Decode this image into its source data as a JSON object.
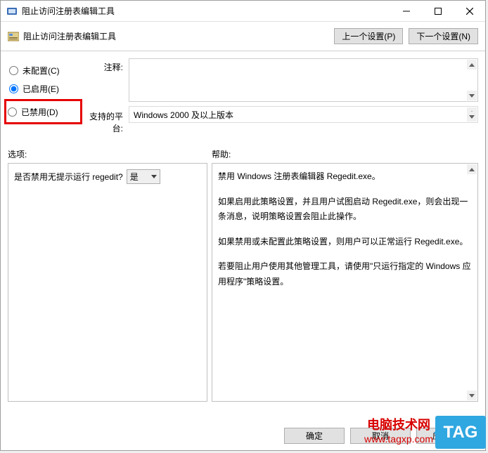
{
  "window": {
    "title": "阻止访问注册表编辑工具"
  },
  "header": {
    "title": "阻止访问注册表编辑工具",
    "prev_btn": "上一个设置(P)",
    "next_btn": "下一个设置(N)"
  },
  "radios": {
    "not_configured": "未配置(C)",
    "enabled": "已启用(E)",
    "disabled": "已禁用(D)",
    "selected": "enabled"
  },
  "labels": {
    "comment": "注释:",
    "supported": "支持的平台:",
    "options": "选项:",
    "help": "帮助:"
  },
  "supported_text": "Windows 2000 及以上版本",
  "option": {
    "label": "是否禁用无提示运行 regedit?",
    "value": "是"
  },
  "help_text": {
    "p1": "禁用 Windows 注册表编辑器 Regedit.exe。",
    "p2": "如果启用此策略设置，并且用户试图启动 Regedit.exe，则会出现一条消息，说明策略设置会阻止此操作。",
    "p3": "如果禁用或未配置此策略设置，则用户可以正常运行 Regedit.exe。",
    "p4": "若要阻止用户使用其他管理工具，请使用\"只运行指定的 Windows 应用程序\"策略设置。"
  },
  "footer": {
    "ok": "确定",
    "cancel": "取消",
    "apply": "应用(A)"
  },
  "watermark": {
    "line1": "电脑技术网",
    "line2": "www.tagxp.com",
    "tag": "TAG"
  }
}
